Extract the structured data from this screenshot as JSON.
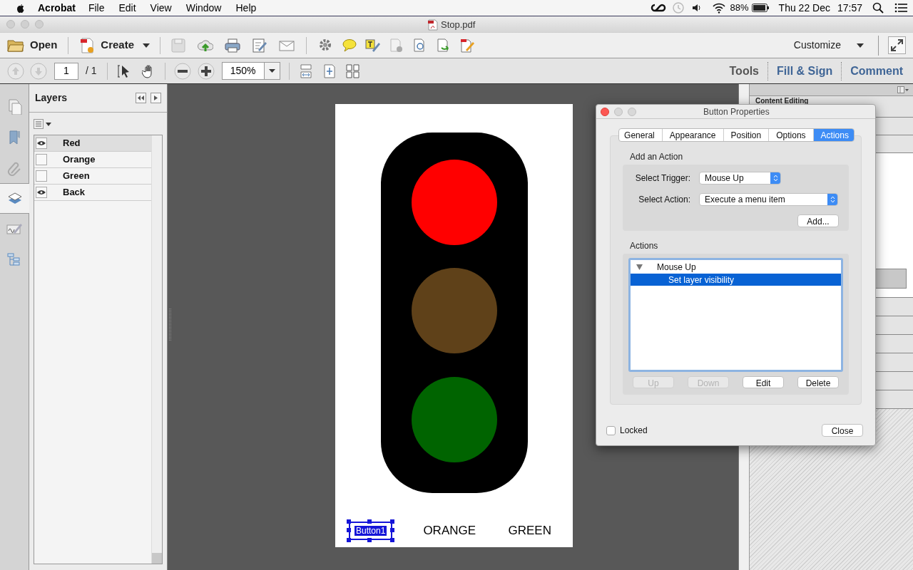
{
  "menu_bar": {
    "app": "Acrobat",
    "menus": [
      "File",
      "Edit",
      "View",
      "Window",
      "Help"
    ],
    "battery": "88%",
    "date": "Thu 22 Dec",
    "time": "17:57"
  },
  "window": {
    "title": "Stop.pdf"
  },
  "toolbar": {
    "open": "Open",
    "create": "Create",
    "customize": "Customize"
  },
  "nav_toolbar": {
    "page": "1",
    "page_count": "/ 1",
    "zoom": "150%",
    "panes": [
      {
        "label": "Tools",
        "color": "#555555"
      },
      {
        "label": "Fill & Sign",
        "color": "#3f6596"
      },
      {
        "label": "Comment",
        "color": "#3f6596"
      }
    ]
  },
  "layers_panel": {
    "title": "Layers",
    "layers": [
      {
        "name": "Red",
        "visible": true,
        "selected": true
      },
      {
        "name": "Orange",
        "visible": false,
        "selected": false
      },
      {
        "name": "Green",
        "visible": false,
        "selected": false
      },
      {
        "name": "Back",
        "visible": true,
        "selected": false
      }
    ]
  },
  "document": {
    "fields": [
      {
        "text": "Button1",
        "selected": true
      },
      {
        "text": "ORANGE",
        "selected": false
      },
      {
        "text": "GREEN",
        "selected": false
      }
    ]
  },
  "right_pane": {
    "heading": "Content Editing"
  },
  "dialog": {
    "title": "Button Properties",
    "tabs": [
      {
        "label": "General",
        "selected": false
      },
      {
        "label": "Appearance",
        "selected": false
      },
      {
        "label": "Position",
        "selected": false
      },
      {
        "label": "Options",
        "selected": false
      },
      {
        "label": "Actions",
        "selected": true
      }
    ],
    "add_action": {
      "title": "Add an Action",
      "trigger_label": "Select Trigger:",
      "trigger": "Mouse Up",
      "action_label": "Select Action:",
      "action": "Execute a menu item",
      "add_button": "Add..."
    },
    "actions": {
      "title": "Actions",
      "tree": [
        {
          "label": "Mouse Up",
          "expanded": true,
          "selected": false,
          "children": [
            {
              "label": "Set layer visibility",
              "selected": true
            }
          ]
        }
      ],
      "buttons": [
        {
          "label": "Up",
          "disabled": true
        },
        {
          "label": "Down",
          "disabled": true
        },
        {
          "label": "Edit",
          "disabled": false
        },
        {
          "label": "Delete",
          "disabled": false
        }
      ]
    },
    "locked": {
      "label": "Locked",
      "checked": false
    },
    "close_button": "Close"
  }
}
